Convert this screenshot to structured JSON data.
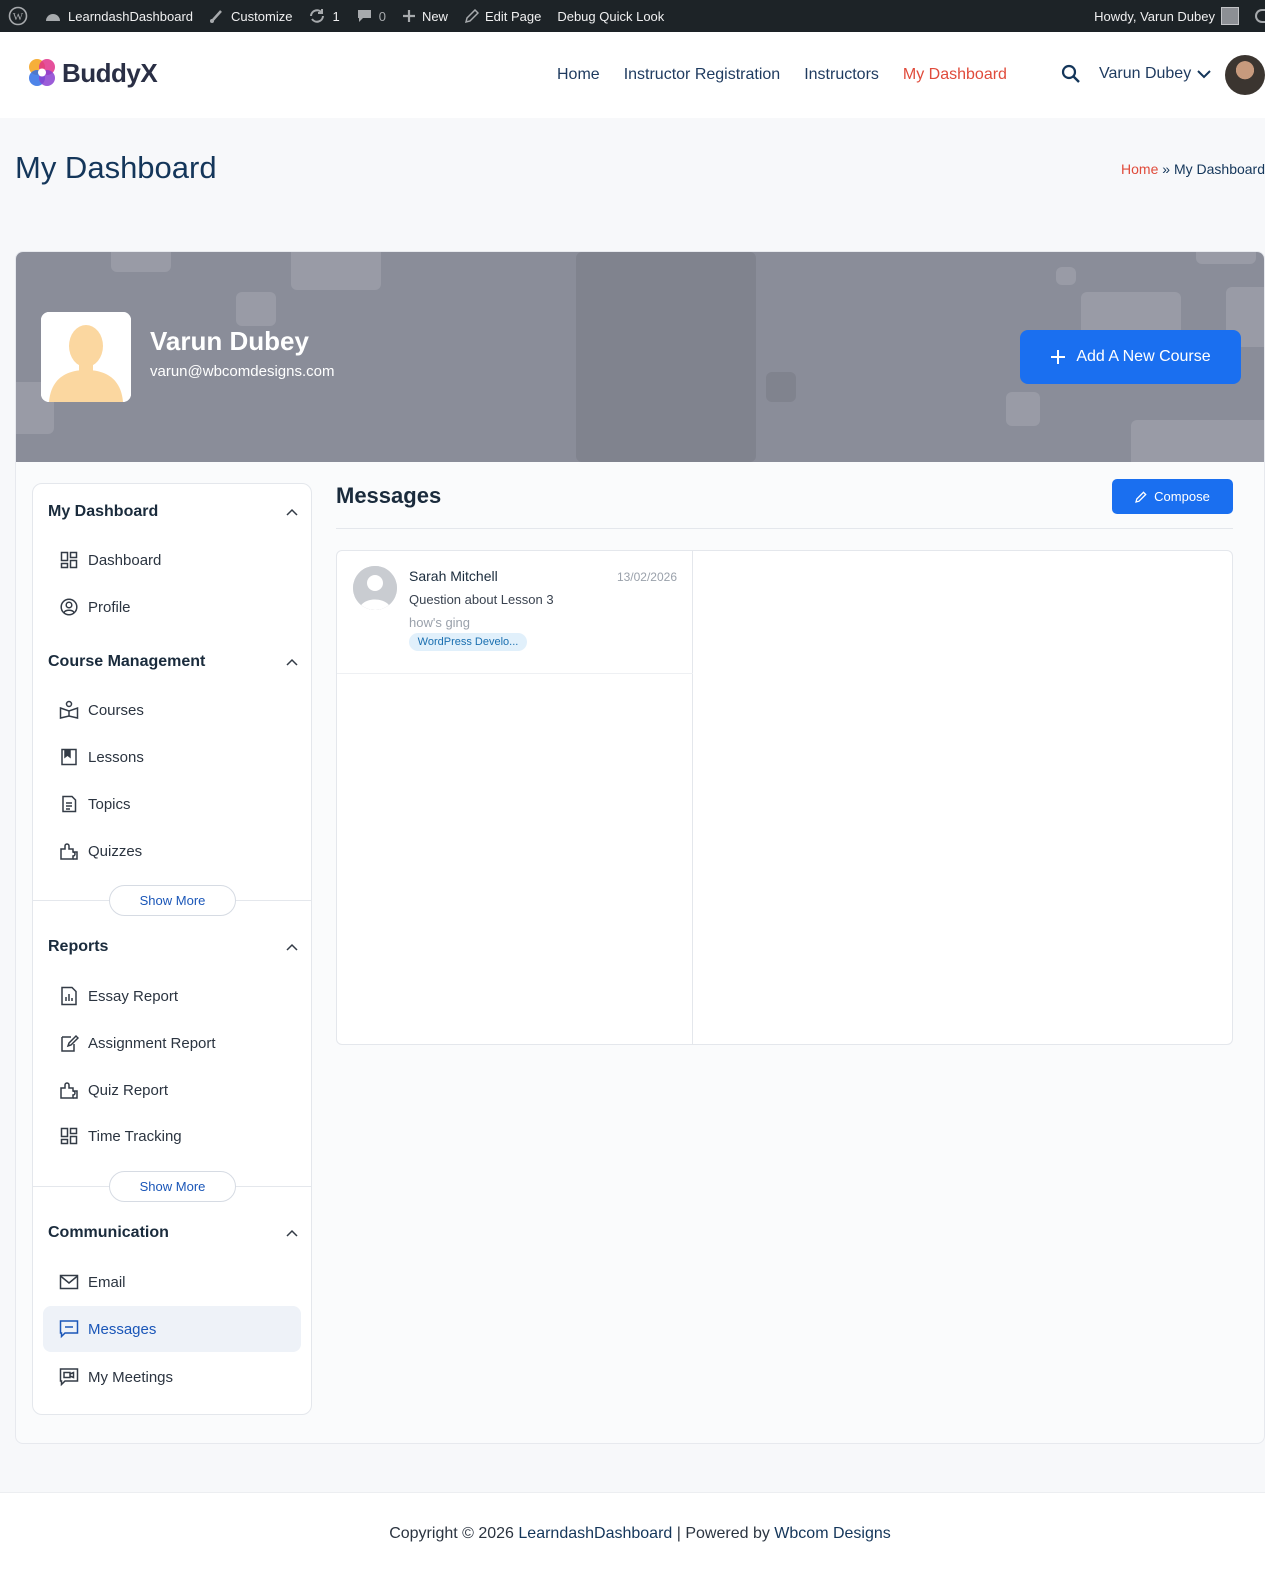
{
  "adminbar": {
    "site": "LearndashDashboard",
    "customize": "Customize",
    "updates_count": "1",
    "comments_count": "0",
    "new": "New",
    "edit_page": "Edit Page",
    "debug": "Debug Quick Look",
    "howdy": "Howdy, Varun Dubey"
  },
  "header": {
    "logo_text": "BuddyX",
    "nav": [
      "Home",
      "Instructor Registration",
      "Instructors",
      "My Dashboard"
    ],
    "active_nav": "My Dashboard",
    "user_name": "Varun Dubey"
  },
  "title_band": {
    "title": "My Dashboard",
    "breadcrumb_home": "Home",
    "breadcrumb_sep": "»",
    "breadcrumb_current": "My Dashboard"
  },
  "profile": {
    "name": "Varun Dubey",
    "email": "varun@wbcomdesigns.com",
    "add_course_label": "Add A New Course"
  },
  "sidebar": {
    "sections": [
      {
        "title": "My Dashboard",
        "items": [
          {
            "label": "Dashboard",
            "icon": "dashboard-icon"
          },
          {
            "label": "Profile",
            "icon": "profile-icon"
          }
        ]
      },
      {
        "title": "Course Management",
        "items": [
          {
            "label": "Courses",
            "icon": "courses-icon"
          },
          {
            "label": "Lessons",
            "icon": "lessons-icon"
          },
          {
            "label": "Topics",
            "icon": "topics-icon"
          },
          {
            "label": "Quizzes",
            "icon": "quizzes-icon"
          }
        ],
        "show_more": "Show More"
      },
      {
        "title": "Reports",
        "items": [
          {
            "label": "Essay Report",
            "icon": "essay-report-icon"
          },
          {
            "label": "Assignment Report",
            "icon": "assignment-report-icon"
          },
          {
            "label": "Quiz Report",
            "icon": "quiz-report-icon"
          },
          {
            "label": "Time Tracking",
            "icon": "time-tracking-icon"
          }
        ],
        "show_more": "Show More"
      },
      {
        "title": "Communication",
        "items": [
          {
            "label": "Email",
            "icon": "email-icon"
          },
          {
            "label": "Messages",
            "icon": "messages-icon"
          },
          {
            "label": "My Meetings",
            "icon": "meetings-icon"
          }
        ]
      }
    ],
    "active_item": "Messages"
  },
  "messages": {
    "title": "Messages",
    "compose_label": "Compose",
    "conversations": [
      {
        "sender": "Sarah Mitchell",
        "date": "13/02/2026",
        "subject": "Question about Lesson 3",
        "preview": "how's ging",
        "tag": "WordPress Develo..."
      }
    ]
  },
  "footer": {
    "prefix": "Copyright © 2026",
    "site_link": "LearndashDashboard",
    "middle": "| Powered by",
    "company_link": "Wbcom Designs"
  },
  "colors": {
    "accent_blue": "#1a6ff0",
    "active_nav": "#e04b3b",
    "admin_bar": "#1d2327"
  }
}
